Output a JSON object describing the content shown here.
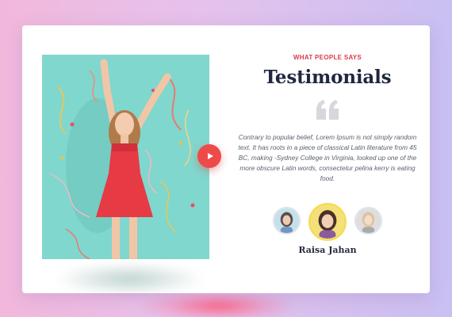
{
  "section": {
    "eyebrow": "WHAT PEOPLE SAYS",
    "title": "Testimonials"
  },
  "testimonial": {
    "quote_icon": "quote-icon",
    "text": "Contrary to popular belief, Lorem Ipsum is not simply random text. It has roots in a piece of classical Latin literature from 45 BC, making -Sydney College in Virginia, looked up one of the more obscure Latin words, consectetur pelina kerry is eating food.",
    "author": "Raisa Jahan"
  },
  "media": {
    "play_icon": "play-icon"
  },
  "colors": {
    "accent": "#d83b4c",
    "play_button": "#ee4a4a",
    "title": "#1f2741",
    "photo_background": "#7fd6cd",
    "active_avatar_ring": "#f5dc59"
  }
}
